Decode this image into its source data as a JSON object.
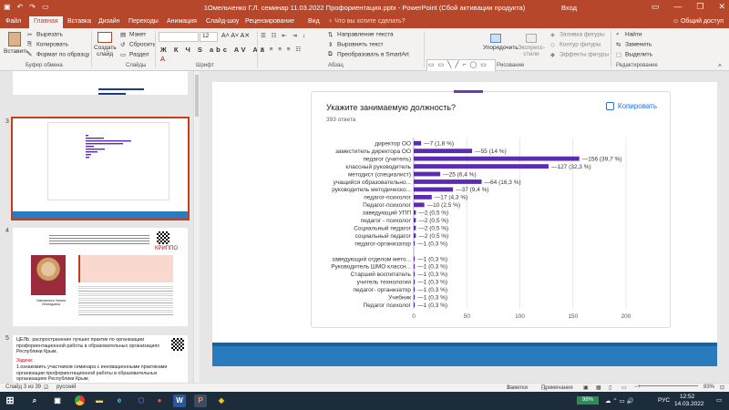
{
  "window": {
    "title": "1Омельченко Г.Л. семинар 11.03.2022 Профориентация.pptx - PowerPoint (Сбой активации продукта)",
    "sign_in": "Вход"
  },
  "tabs": [
    "Файл",
    "Главная",
    "Вставка",
    "Дизайн",
    "Переходы",
    "Анимация",
    "Слайд-шоу",
    "Рецензирование",
    "Вид"
  ],
  "active_tab": "Главная",
  "search_placeholder": "Что вы хотите сделать?",
  "share": "Общий доступ",
  "ribbon": {
    "paste": "Вставить",
    "cut": "Вырезать",
    "copy": "Копировать",
    "format_painter": "Формат по образцу",
    "new_slide": "Создать слайд",
    "layout": "Макет",
    "reset": "Сбросить",
    "section": "Раздел",
    "font_size": "12",
    "text_direction": "Направление текста",
    "align_text": "Выровнять текст",
    "smartart": "Преобразовать в SmartArt",
    "arrange": "Упорядочить",
    "quick_styles": "Экспресс-стили",
    "shape_fill": "Заливка фигуры",
    "shape_outline": "Контур фигуры",
    "shape_effects": "Эффекты фигуры",
    "find": "Найти",
    "replace": "Заменить",
    "select": "Выделить",
    "groups": {
      "clipboard": "Буфер обмена",
      "slides": "Слайды",
      "font": "Шрифт",
      "paragraph": "Абзац",
      "drawing": "Рисование",
      "editing": "Редактирование"
    }
  },
  "thumbnails": {
    "slide3_num": "3",
    "slide4_num": "4",
    "slide5_num": "5",
    "slide5_title": "ЦЕЛЬ: распространение лучших практик по организации профориентационной работы в образовательных организациях Республики Крым.",
    "slide5_tasks": "Задачи:",
    "slide5_text": "1.ознакомить участников семинара с инновационными практиками организации профориентационной работы в образовательных организациях Республики Крым;",
    "slide4_name": "Омельченко Галина Леонидовна",
    "slide4_logo": "КРИППО"
  },
  "form": {
    "question": "Укажите занимаемую должность?",
    "responses": "393 ответа",
    "copy_label": "Копировать"
  },
  "chart_data": {
    "type": "bar",
    "orientation": "horizontal",
    "color": "#5b2bb5",
    "xlim": [
      0,
      200
    ],
    "xticks": [
      0,
      50,
      100,
      150,
      200
    ],
    "categories": [
      "директор ОО",
      "заместитель директора ОО",
      "педагог (учитель)",
      "классный руководитель",
      "методист (специалист)",
      "учащийся образовательно...",
      "руководитель методическо...",
      "педагог-психолог",
      "Педагог-психолог",
      "заведующий УПП",
      "педагог - психолог",
      "Социальный педагог",
      "социальный педагог",
      "педагог-организатор",
      "",
      "заведующий отделом мето...",
      "Руководитель ШМО классн...",
      "Старший воспитатель",
      "учитель технологии",
      "педагог- организатор",
      "Учебник",
      "Педагог психолог"
    ],
    "values": [
      7,
      55,
      156,
      127,
      25,
      64,
      37,
      17,
      10,
      2,
      2,
      2,
      2,
      1,
      null,
      1,
      1,
      1,
      1,
      1,
      1,
      1
    ],
    "labels": [
      "7 (1,8 %)",
      "55 (14 %)",
      "156 (39,7 %)",
      "127 (32,3 %)",
      "25 (6,4 %)",
      "64 (16,3 %)",
      "37 (9,4 %)",
      "17 (4,3 %)",
      "10 (2,5 %)",
      "2 (0,5 %)",
      "2 (0,5 %)",
      "2 (0,5 %)",
      "2 (0,5 %)",
      "1 (0,3 %)",
      "",
      "1 (0,3 %)",
      "1 (0,3 %)",
      "1 (0,3 %)",
      "1 (0,3 %)",
      "1 (0,3 %)",
      "1 (0,3 %)",
      "1 (0,3 %)"
    ]
  },
  "status": {
    "slide": "Слайд 3 из 39",
    "lang": "русский",
    "notes": "Заметки",
    "comments": "Примечания",
    "zoom": "83%"
  },
  "taskbar": {
    "battery": "98%",
    "lang": "РУС",
    "time": "12:52",
    "date": "14.03.2022"
  }
}
